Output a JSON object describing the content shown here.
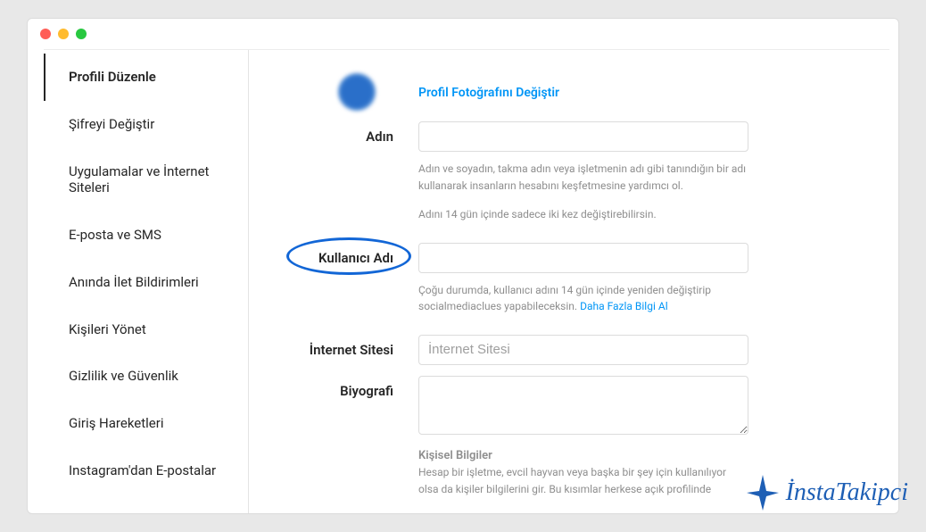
{
  "sidebar": {
    "items": [
      {
        "label": "Profili Düzenle",
        "active": true
      },
      {
        "label": "Şifreyi Değiştir",
        "active": false
      },
      {
        "label": "Uygulamalar ve İnternet Siteleri",
        "active": false
      },
      {
        "label": "E-posta ve SMS",
        "active": false
      },
      {
        "label": "Anında İlet Bildirimleri",
        "active": false
      },
      {
        "label": "Kişileri Yönet",
        "active": false
      },
      {
        "label": "Gizlilik ve Güvenlik",
        "active": false
      },
      {
        "label": "Giriş Hareketleri",
        "active": false
      },
      {
        "label": "Instagram'dan E-postalar",
        "active": false
      }
    ]
  },
  "profile": {
    "change_photo": "Profil Fotoğrafını Değiştir",
    "name_label": "Adın",
    "name_value": "",
    "name_hint1": "Adın ve soyadın, takma adın veya işletmenin adı gibi tanındığın bir adı kullanarak insanların hesabını keşfetmesine yardımcı ol.",
    "name_hint2": "Adını 14 gün içinde sadece iki kez değiştirebilirsin.",
    "username_label": "Kullanıcı Adı",
    "username_value": "",
    "username_hint": "Çoğu durumda, kullanıcı adını 14 gün içinde yeniden değiştirip socialmediaclues yapabileceksin. ",
    "username_link": "Daha Fazla Bilgi Al",
    "website_label": "İnternet Sitesi",
    "website_placeholder": "İnternet Sitesi",
    "website_value": "",
    "bio_label": "Biyografi",
    "bio_value": "",
    "personal_head": "Kişisel Bilgiler",
    "personal_hint": "Hesap bir işletme, evcil hayvan veya başka bir şey için kullanılıyor olsa da kişiler bilgilerini gir. Bu kısımlar herkese açık profilinde"
  },
  "watermark": {
    "text": "İnstaTakipci"
  }
}
